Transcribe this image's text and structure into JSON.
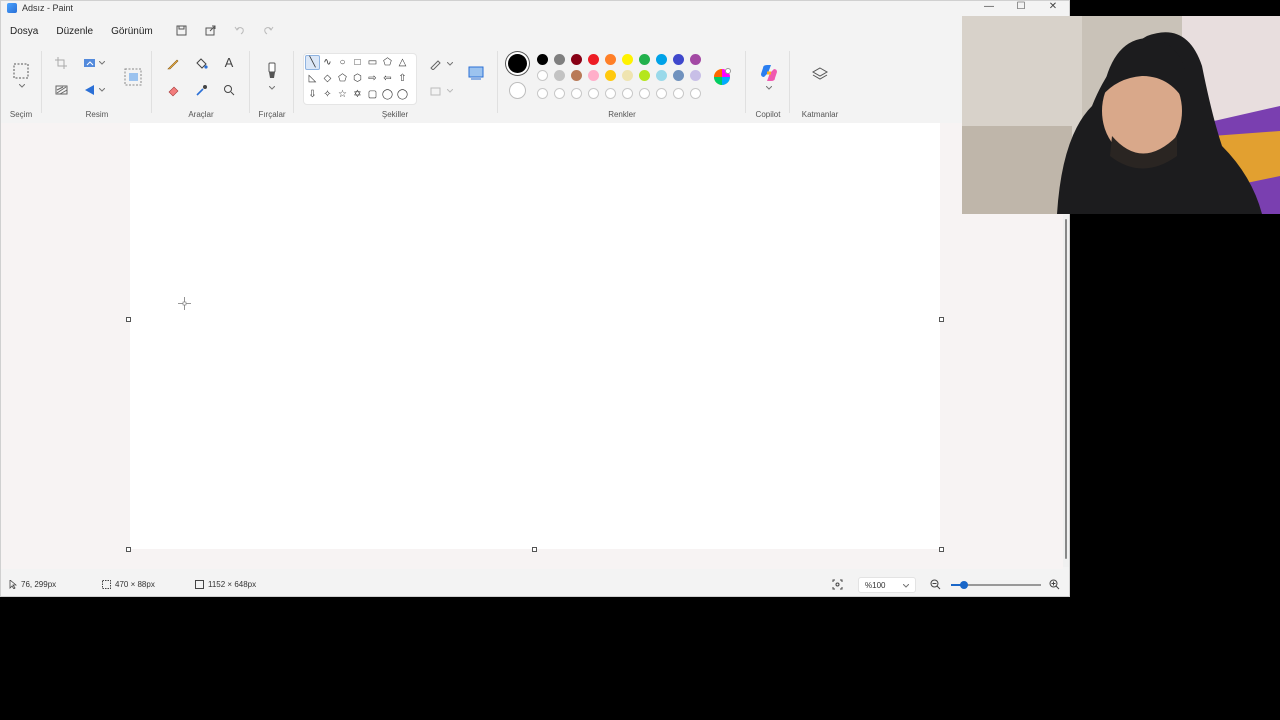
{
  "window": {
    "title": "Adsız - Paint",
    "minimize_glyph": "—",
    "maximize_glyph": "☐",
    "close_glyph": "✕"
  },
  "menu": [
    "Dosya",
    "Düzenle",
    "Görünüm"
  ],
  "ribbon": {
    "groups": {
      "selection": "Seçim",
      "image": "Resim",
      "tools": "Araçlar",
      "brushes": "Fırçalar",
      "shapes": "Şekiller",
      "colors": "Renkler",
      "copilot": "Copilot",
      "layers": "Katmanlar"
    },
    "text_tool_glyph": "A",
    "shape_glyphs": [
      [
        "╲",
        "∿",
        "○",
        "□",
        "▭",
        "⬠",
        "△"
      ],
      [
        "◺",
        "◇",
        "⬠",
        "⬡",
        "⇨",
        "⇦",
        "⇧"
      ],
      [
        "⇩",
        "✧",
        "☆",
        "✡",
        "▢",
        "◯",
        "◯"
      ]
    ],
    "palette_row1": [
      "#000000",
      "#7f7f7f",
      "#880015",
      "#ed1c24",
      "#ff7f27",
      "#fff200",
      "#22b14c",
      "#00a2e8",
      "#3f48cc",
      "#a349a4"
    ],
    "palette_row2": [
      "#ffffff",
      "#c3c3c3",
      "#b97a57",
      "#ffaec9",
      "#ffc90e",
      "#efe4b0",
      "#b5e61d",
      "#99d9ea",
      "#7092be",
      "#c8bfe7"
    ],
    "primary_color": "#000000",
    "secondary_color": "#ffffff"
  },
  "status": {
    "cursor_position": "76, 299px",
    "selection_size": "470 × 88px",
    "canvas_size": "1152 × 648px",
    "zoom_level": "%100"
  }
}
